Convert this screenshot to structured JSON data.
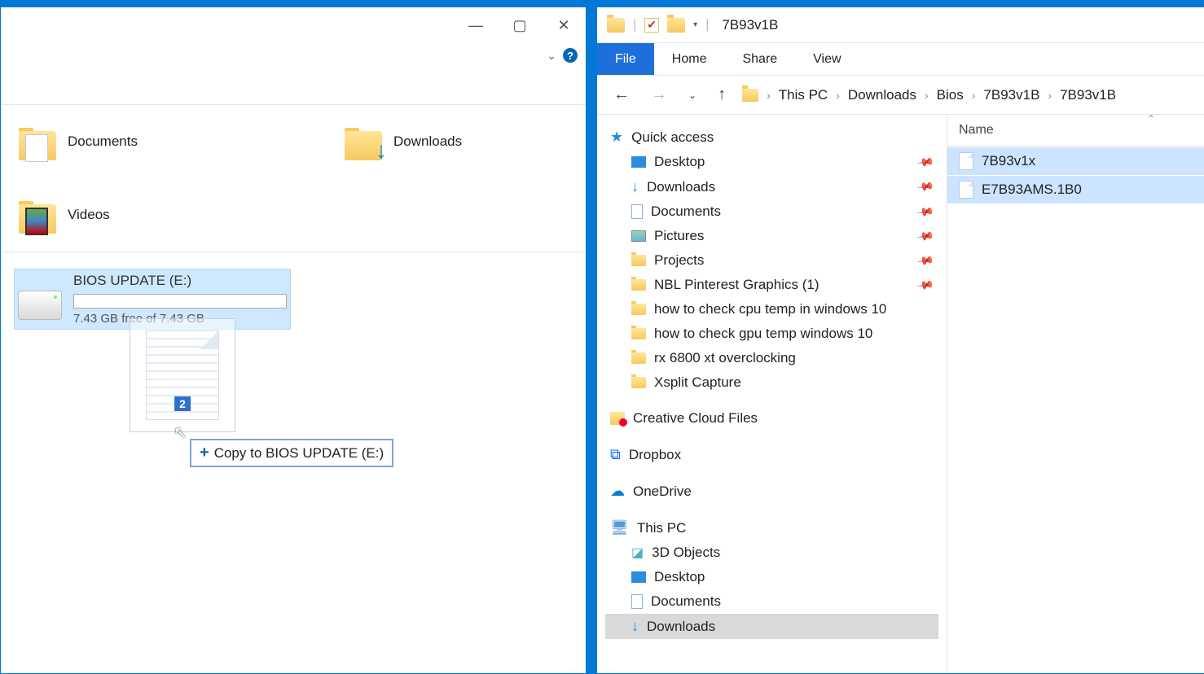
{
  "left": {
    "folders": [
      {
        "label": "Documents",
        "type": "doc"
      },
      {
        "label": "Downloads",
        "type": "dl"
      },
      {
        "label": "Videos",
        "type": "vid"
      }
    ],
    "drive": {
      "name": "BIOS UPDATE (E:)",
      "free": "7.43 GB free of 7.43 GB"
    },
    "drag": {
      "count": "2",
      "tip": "Copy to BIOS UPDATE (E:)"
    }
  },
  "right": {
    "title": "7B93v1B",
    "tabs": {
      "file": "File",
      "home": "Home",
      "share": "Share",
      "view": "View"
    },
    "breadcrumb": [
      "This PC",
      "Downloads",
      "Bios",
      "7B93v1B",
      "7B93v1B"
    ],
    "nav": {
      "quick": "Quick access",
      "pinned": [
        {
          "label": "Desktop",
          "icon": "desktop"
        },
        {
          "label": "Downloads",
          "icon": "dlarrow"
        },
        {
          "label": "Documents",
          "icon": "doc"
        },
        {
          "label": "Pictures",
          "icon": "pic"
        },
        {
          "label": "Projects",
          "icon": "folder"
        },
        {
          "label": "NBL Pinterest Graphics (1)",
          "icon": "folder"
        }
      ],
      "recent": [
        "how to check cpu temp in windows 10",
        "how to check gpu temp windows 10",
        "rx 6800 xt overclocking",
        "Xsplit Capture"
      ],
      "cc": "Creative Cloud Files",
      "dropbox": "Dropbox",
      "onedrive": "OneDrive",
      "thispc": "This PC",
      "pcchildren": [
        {
          "label": "3D Objects",
          "icon": "3d"
        },
        {
          "label": "Desktop",
          "icon": "desktop"
        },
        {
          "label": "Documents",
          "icon": "doc"
        },
        {
          "label": "Downloads",
          "icon": "dlarrow",
          "selected": true
        }
      ]
    },
    "list": {
      "header": "Name",
      "files": [
        "7B93v1x",
        "E7B93AMS.1B0"
      ]
    }
  }
}
